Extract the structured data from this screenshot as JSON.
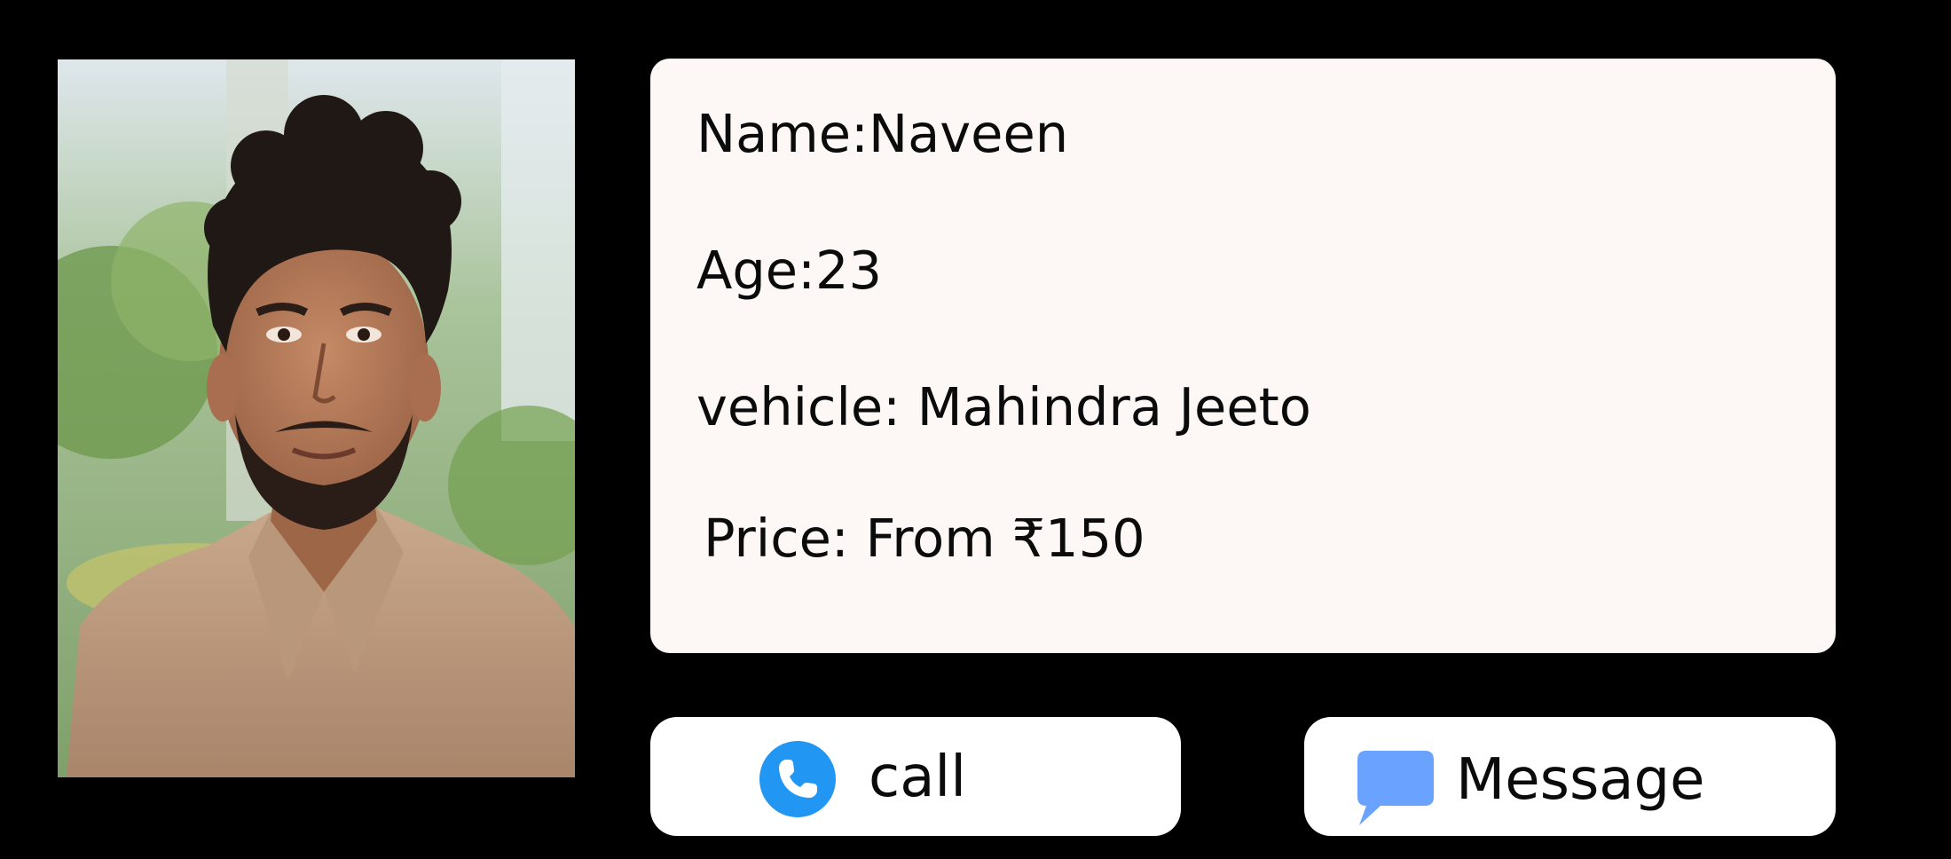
{
  "profile": {
    "name_line": "Name:Naveen",
    "age_line": "Age:23",
    "vehicle_line": "vehicle: Mahindra Jeeto",
    "price_line": "Price: From ₹150"
  },
  "actions": {
    "call_label": "call",
    "call_icon": "phone-icon",
    "message_label": "Message",
    "message_icon": "chat-bubble-icon"
  },
  "colors": {
    "page_background": "#000000",
    "card_background": "#fdf7f6",
    "button_background": "#ffffff",
    "call_icon": "#2196f3",
    "message_icon": "#6aa2ff",
    "text": "#0b0b0b"
  }
}
